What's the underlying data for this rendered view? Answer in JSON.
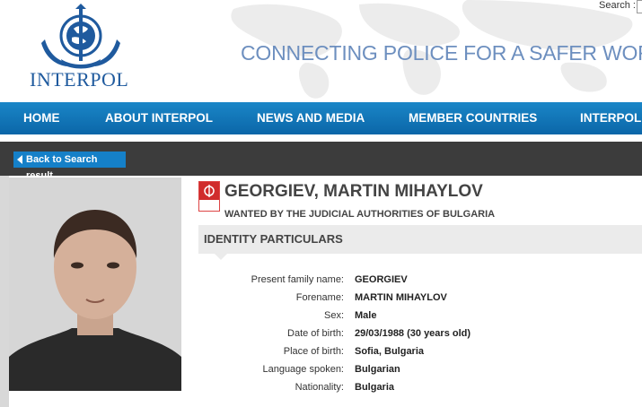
{
  "header": {
    "logo_text": "INTERPOL",
    "tagline": "CONNECTING POLICE FOR A SAFER WORLD",
    "search_label": "Search :",
    "search_value": ""
  },
  "nav": {
    "items": [
      {
        "label": "HOME"
      },
      {
        "label": "ABOUT INTERPOL"
      },
      {
        "label": "NEWS AND MEDIA"
      },
      {
        "label": "MEMBER COUNTRIES"
      },
      {
        "label": "INTERPOL"
      }
    ]
  },
  "back_button": {
    "label": "Back to Search result"
  },
  "notice": {
    "icon_text": "RED NOTICE",
    "name": "GEORGIEV, MARTIN MIHAYLOV",
    "subtitle": "WANTED BY THE JUDICIAL AUTHORITIES OF BULGARIA"
  },
  "section_title": "IDENTITY PARTICULARS",
  "particulars": [
    {
      "label": "Present family name:",
      "value": "GEORGIEV"
    },
    {
      "label": "Forename:",
      "value": "MARTIN MIHAYLOV"
    },
    {
      "label": "Sex:",
      "value": "Male"
    },
    {
      "label": "Date of birth:",
      "value": "29/03/1988 (30 years old)"
    },
    {
      "label": "Place of birth:",
      "value": "Sofia, Bulgaria"
    },
    {
      "label": "Language spoken:",
      "value": "Bulgarian"
    },
    {
      "label": "Nationality:",
      "value": "Bulgaria"
    }
  ],
  "colors": {
    "nav": "#0b66a8",
    "accent": "#1580c8",
    "dark_bar": "#3c3c3c"
  }
}
